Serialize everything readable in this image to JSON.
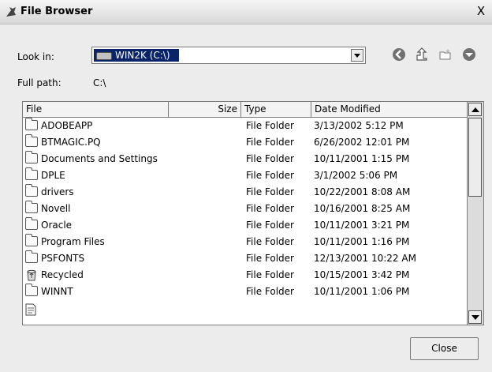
{
  "window": {
    "title": "File Browser",
    "close_glyph": "X"
  },
  "look_in": {
    "label": "Look in:",
    "value": "WIN2K (C:\\)",
    "icon": "drive-icon"
  },
  "full_path": {
    "label": "Full path:",
    "value": "C:\\"
  },
  "toolbar": {
    "icons": [
      "back-icon",
      "up-folder-icon",
      "new-folder-icon",
      "menu-down-icon"
    ]
  },
  "columns": [
    "File",
    "Size",
    "Type",
    "Date Modified"
  ],
  "rows": [
    {
      "name": "ADOBEAPP",
      "size": "",
      "type": "File Folder",
      "date": "3/13/2002 5:12 PM",
      "icon": "folder-icon"
    },
    {
      "name": "BTMAGIC.PQ",
      "size": "",
      "type": "File Folder",
      "date": "6/26/2002 12:01 PM",
      "icon": "folder-icon"
    },
    {
      "name": "Documents and Settings",
      "size": "",
      "type": "File Folder",
      "date": "10/11/2001 1:15 PM",
      "icon": "folder-icon"
    },
    {
      "name": "DPLE",
      "size": "",
      "type": "File Folder",
      "date": "3/1/2002 5:06 PM",
      "icon": "folder-icon"
    },
    {
      "name": "drivers",
      "size": "",
      "type": "File Folder",
      "date": "10/22/2001 8:08 AM",
      "icon": "folder-icon"
    },
    {
      "name": "Novell",
      "size": "",
      "type": "File Folder",
      "date": "10/16/2001 8:25 AM",
      "icon": "folder-icon"
    },
    {
      "name": "Oracle",
      "size": "",
      "type": "File Folder",
      "date": "10/11/2001 3:21 PM",
      "icon": "folder-icon"
    },
    {
      "name": "Program Files",
      "size": "",
      "type": "File Folder",
      "date": "10/11/2001 1:16 PM",
      "icon": "folder-icon"
    },
    {
      "name": "PSFONTS",
      "size": "",
      "type": "File Folder",
      "date": "12/13/2001 10:22 AM",
      "icon": "folder-icon"
    },
    {
      "name": "Recycled",
      "size": "",
      "type": "File Folder",
      "date": "10/15/2001 3:42 PM",
      "icon": "recycle-icon"
    },
    {
      "name": "WINNT",
      "size": "",
      "type": "File Folder",
      "date": "10/11/2001 1:06 PM",
      "icon": "folder-icon"
    }
  ],
  "buttons": {
    "close": "Close"
  }
}
